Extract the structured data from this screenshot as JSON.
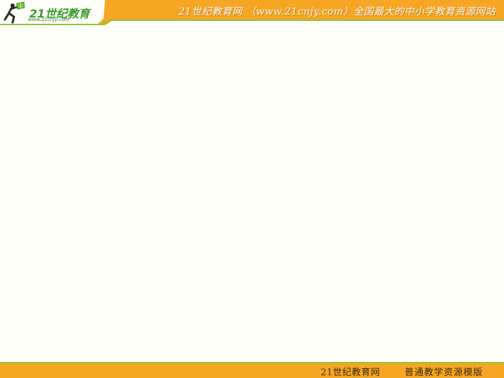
{
  "header": {
    "logo_text": "21世纪教育",
    "logo_subtext": "www.21cnjy.com",
    "title": "21世纪教育网 （www.21cnjy.com）全国最大的中小学教育资源网站"
  },
  "footer": {
    "left_text": "21世纪教育网",
    "right_text": "普通教学资源模版"
  },
  "colors": {
    "accent_orange": "#f6a623",
    "accent_green": "#8cc63f",
    "background": "#fffff9"
  },
  "icons": {
    "logo": "runner-with-book-icon"
  }
}
